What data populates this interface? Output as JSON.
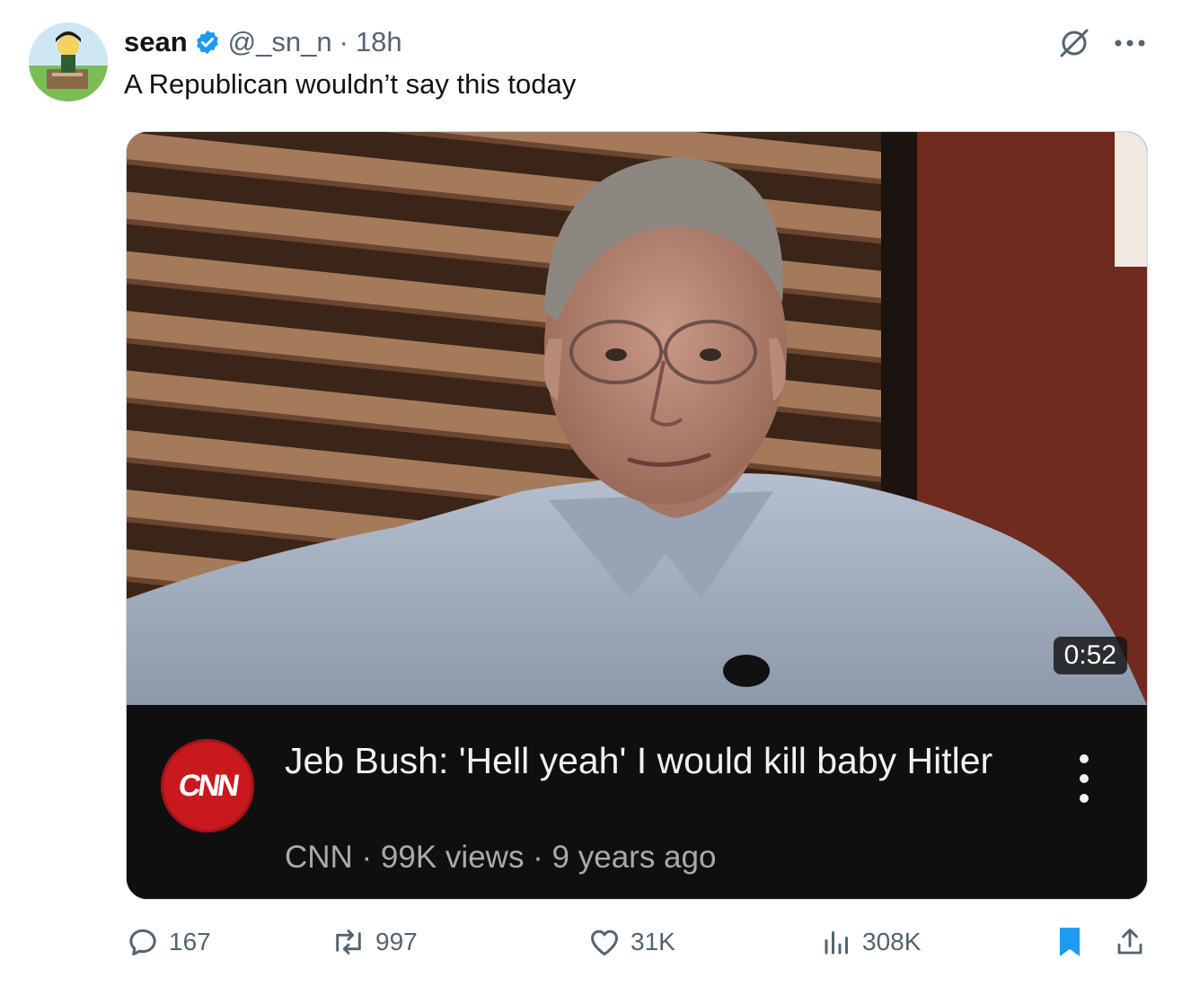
{
  "tweet": {
    "display_name": "sean",
    "handle": "@_sn_n",
    "separator": "·",
    "time": "18h",
    "text": "A Republican wouldn’t say this today"
  },
  "video": {
    "duration": "0:52",
    "channel_logo_text": "CNN",
    "title": "Jeb Bush: 'Hell yeah' I would kill baby Hitler",
    "meta": "CNN · 99K views · 9 years ago"
  },
  "actions": {
    "replies": "167",
    "reposts": "997",
    "likes": "31K",
    "views": "308K"
  },
  "colors": {
    "verified": "#1d9bf0",
    "bookmark": "#1d9bf0",
    "secondary_text": "#536471",
    "cnn_red": "#c8191f"
  },
  "icons": [
    "verified-badge-icon",
    "grok-icon",
    "more-icon",
    "kebab-icon",
    "reply-icon",
    "repost-icon",
    "like-icon",
    "views-icon",
    "bookmark-icon",
    "share-icon"
  ]
}
